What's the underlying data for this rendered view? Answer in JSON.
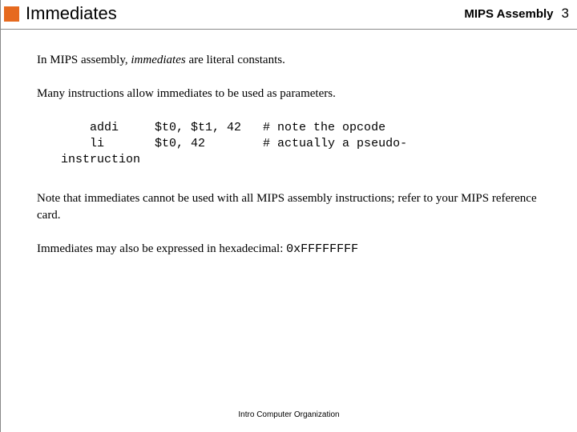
{
  "header": {
    "title": "Immediates",
    "subject": "MIPS Assembly",
    "page": "3"
  },
  "body": {
    "p1_a": "In MIPS assembly, ",
    "p1_b": "immediates",
    "p1_c": " are literal constants.",
    "p2": "Many instructions allow immediates to be used as parameters.",
    "code": "    addi     $t0, $t1, 42   # note the opcode\n    li       $t0, 42        # actually a pseudo-\ninstruction",
    "p3": "Note that immediates cannot be used with all MIPS assembly instructions; refer to your MIPS reference card.",
    "p4_a": "Immediates may also be expressed in hexadecimal:  ",
    "p4_b": "0xFFFFFFFF"
  },
  "footer": "Intro Computer Organization"
}
